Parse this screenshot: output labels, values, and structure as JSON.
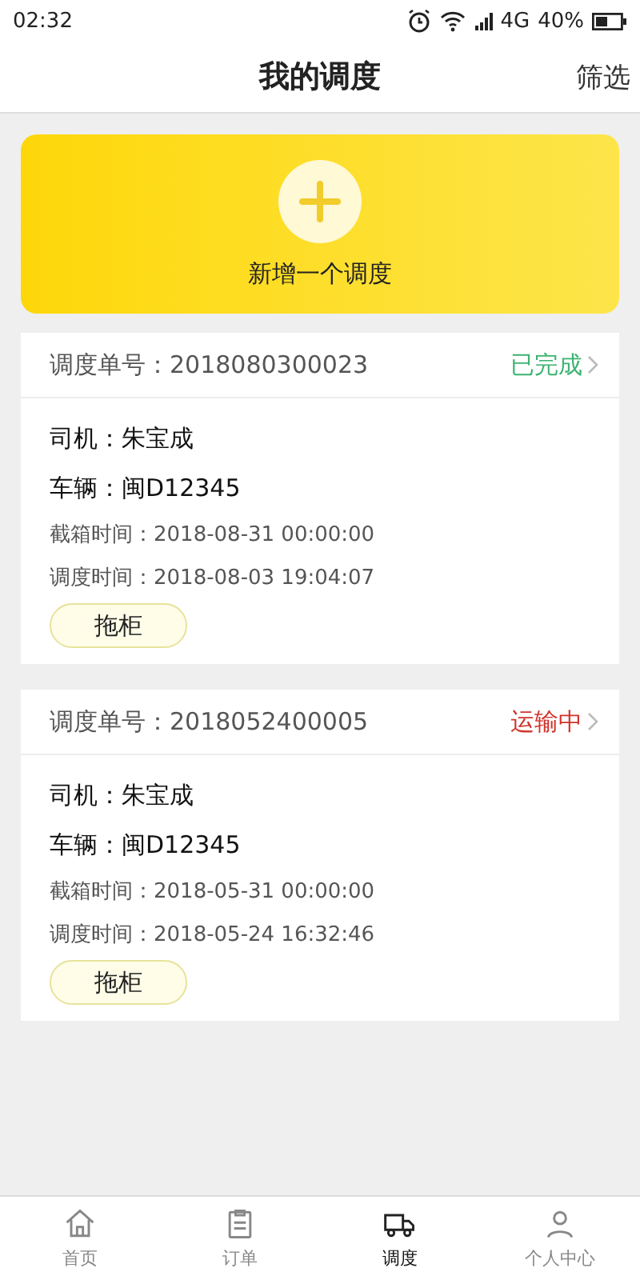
{
  "status_bar": {
    "time": "02:32",
    "network": "4G",
    "battery": "40%"
  },
  "header": {
    "title": "我的调度",
    "action": "筛选"
  },
  "add_card": {
    "label": "新增一个调度"
  },
  "orders": [
    {
      "number_label": "调度单号：",
      "number": "2018080300023",
      "status": "已完成",
      "color": "#3cb371",
      "driver": "司机：朱宝成",
      "vehicle": "车辆：闽D12345",
      "cutoff": "截箱时间：2018-08-31 00:00:00",
      "dispatch_time": "调度时间：2018-08-03 19:04:07",
      "action": "拖柜"
    },
    {
      "number_label": "调度单号：",
      "number": "2018052400005",
      "status": "运输中",
      "color": "#d0342c",
      "driver": "司机：朱宝成",
      "vehicle": "车辆：闽D12345",
      "cutoff": "截箱时间：2018-05-31 00:00:00",
      "dispatch_time": "调度时间：2018-05-24 16:32:46",
      "action": "拖柜"
    }
  ],
  "tab_bar": [
    {
      "label": "首页",
      "selected": false,
      "kind": "home"
    },
    {
      "label": "订单",
      "selected": false,
      "kind": "order"
    },
    {
      "label": "调度",
      "selected": true,
      "kind": "dispatch"
    },
    {
      "label": "个人中心",
      "selected": false,
      "kind": "user"
    }
  ]
}
